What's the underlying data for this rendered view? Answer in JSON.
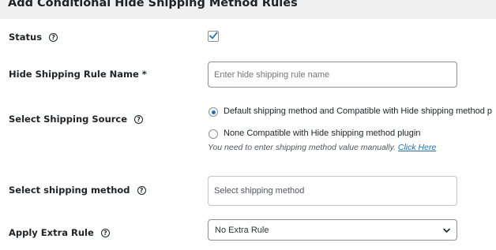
{
  "header": {
    "title": "Add Conditional Hide Shipping Method Rules"
  },
  "form": {
    "status": {
      "label": "Status",
      "checked": true,
      "help_icon": "help-circle-icon"
    },
    "rule_name": {
      "label": "Hide Shipping Rule Name *",
      "value": "",
      "placeholder": "Enter hide shipping rule name"
    },
    "shipping_source": {
      "label": "Select Shipping Source",
      "help_icon": "help-circle-icon",
      "options": [
        {
          "label": "Default shipping method and Compatible with Hide shipping method p",
          "checked": true
        },
        {
          "label": "None Compatible with Hide shipping method plugin",
          "checked": false
        }
      ],
      "note": "You need to enter shipping method value manually.",
      "note_link": "Click Here"
    },
    "shipping_method": {
      "label": "Select shipping method",
      "placeholder": "Select shipping method",
      "help_icon": "help-circle-icon"
    },
    "extra_rule": {
      "label": "Apply Extra Rule",
      "selected": "No Extra Rule",
      "help_icon": "help-circle-icon"
    }
  },
  "colors": {
    "accent": "#2271b1",
    "header_bg": "#f0f0f1",
    "border": "#8c8f94",
    "text": "#1d2327"
  }
}
